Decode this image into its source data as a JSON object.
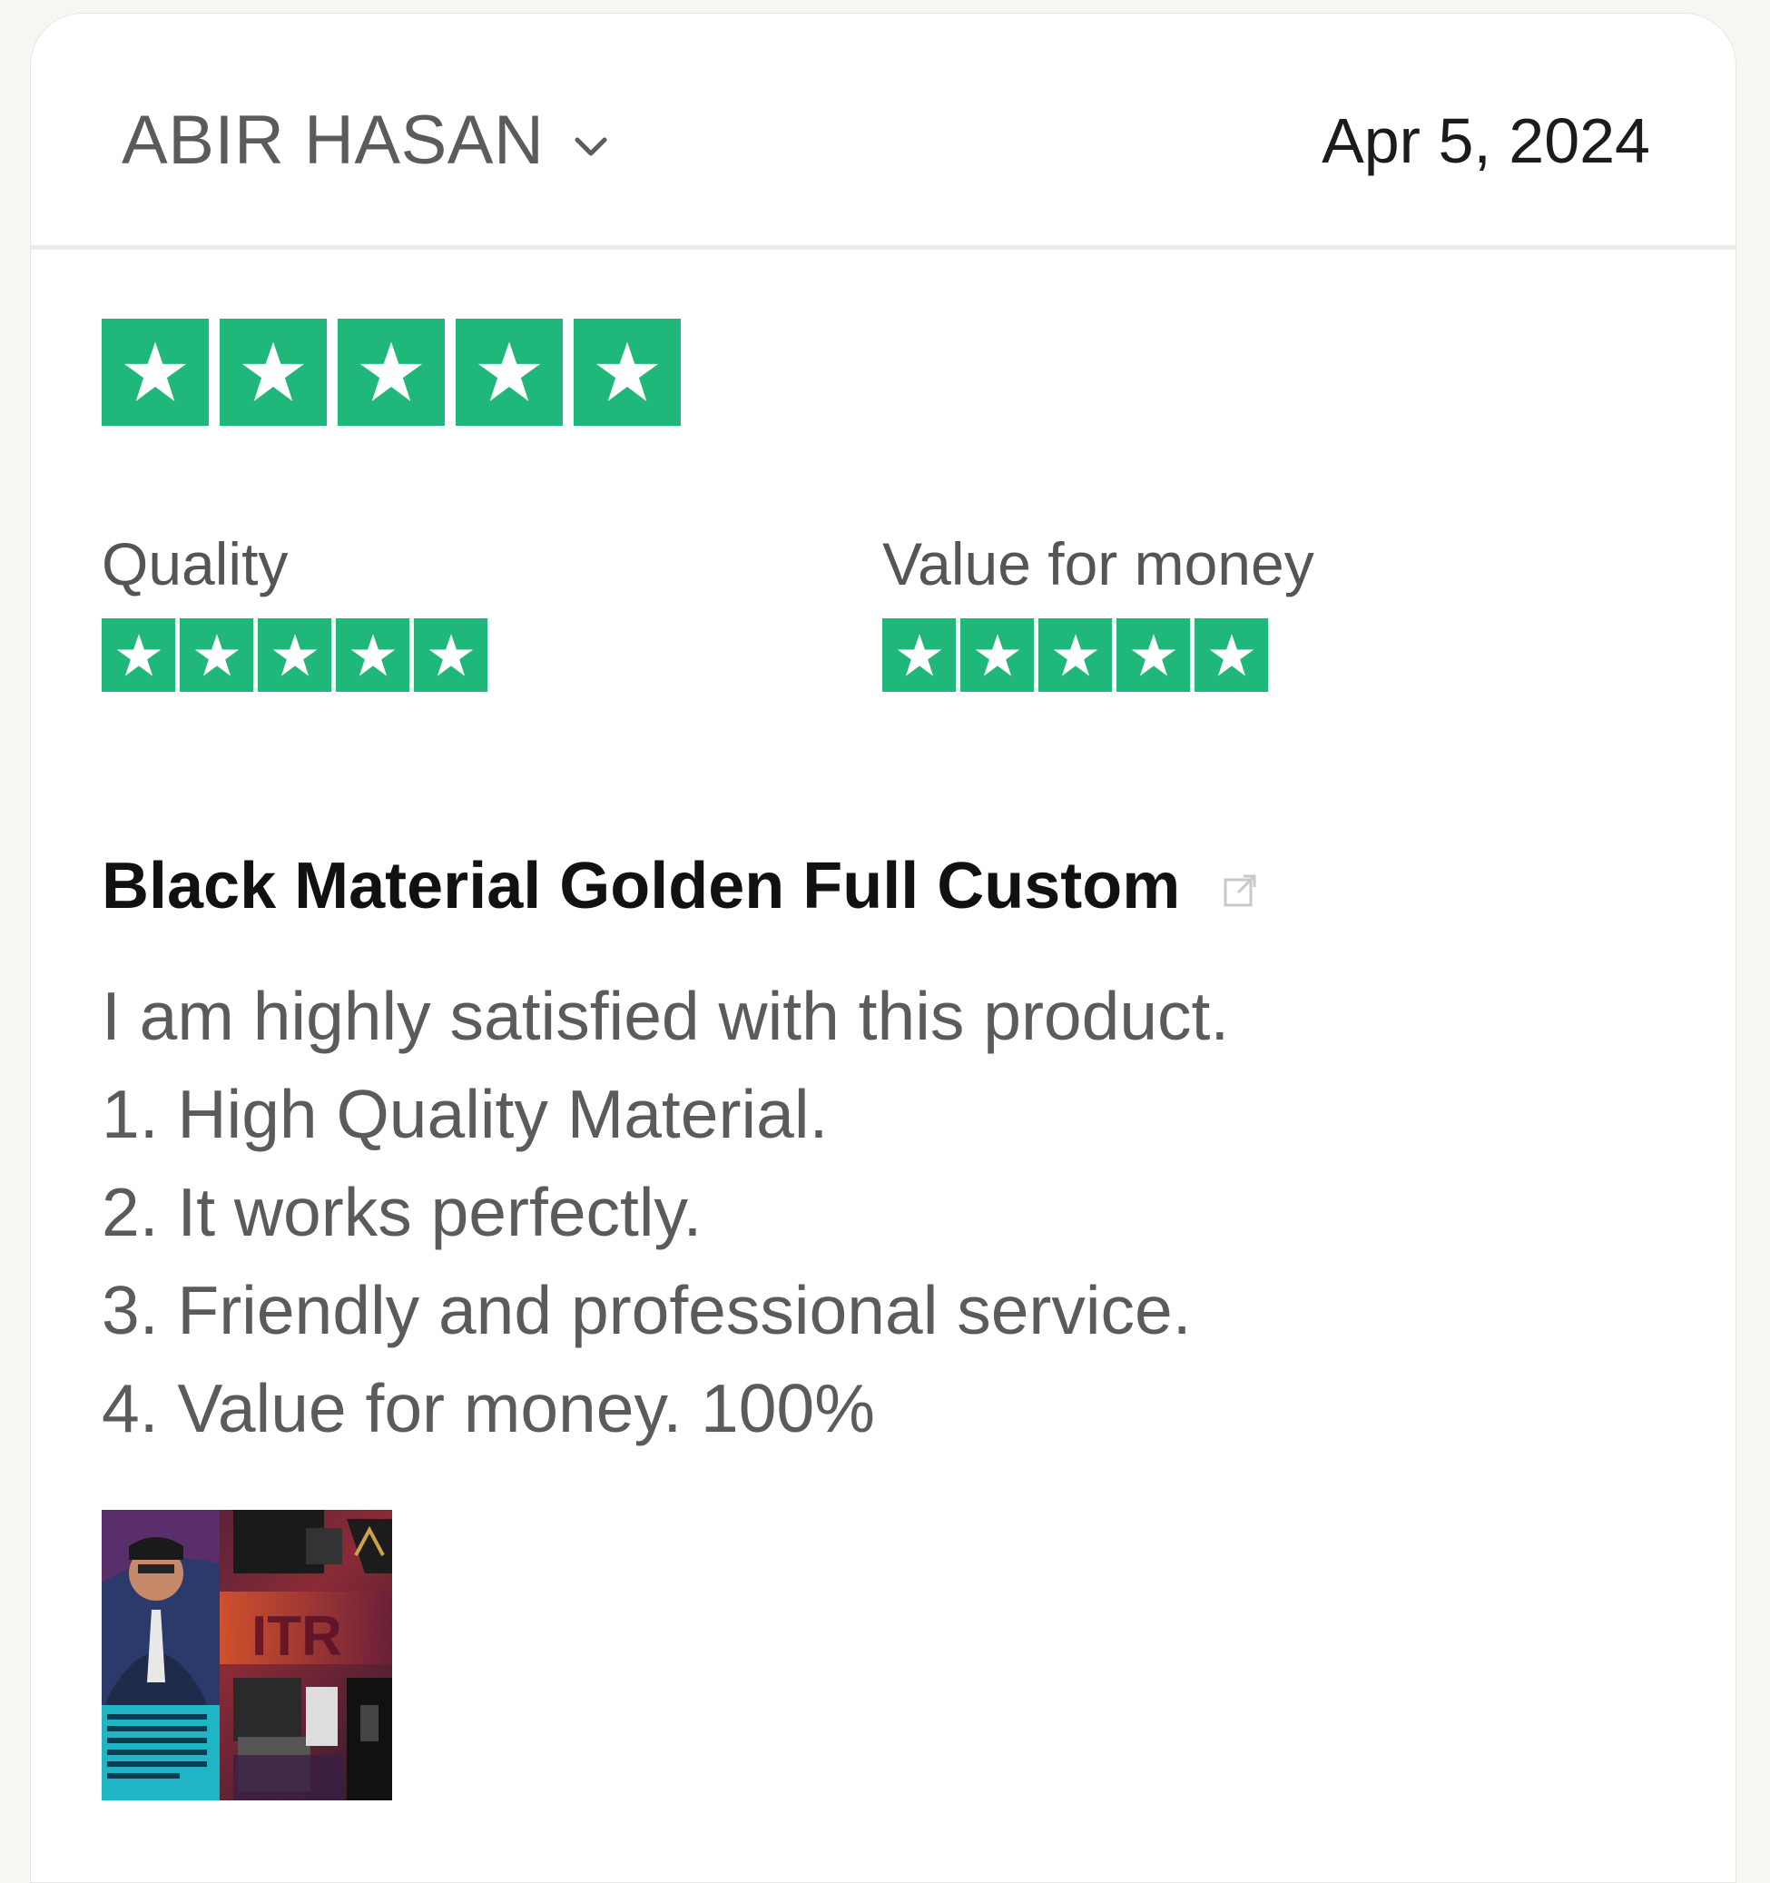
{
  "review": {
    "reviewer_name": "ABIR HASAN",
    "date": "Apr 5, 2024",
    "overall_rating": 5,
    "sub_ratings": [
      {
        "label": "Quality",
        "rating": 5
      },
      {
        "label": "Value for money",
        "rating": 5
      }
    ],
    "title": "Black Material Golden Full Custom",
    "body_lines": [
      "I am highly satisfied with this product.",
      "1. High Quality Material.",
      "2. It works perfectly.",
      "3. Friendly and professional service.",
      "4. Value for money. 100%"
    ],
    "icons": {
      "dropdown": "chevron-down-icon",
      "star": "star-icon",
      "external_link": "external-link-icon"
    }
  },
  "colors": {
    "star_green": "#20b77a",
    "name_gray": "#5b5b5b",
    "date_black": "#1b1b1b",
    "title_black": "#111111"
  }
}
